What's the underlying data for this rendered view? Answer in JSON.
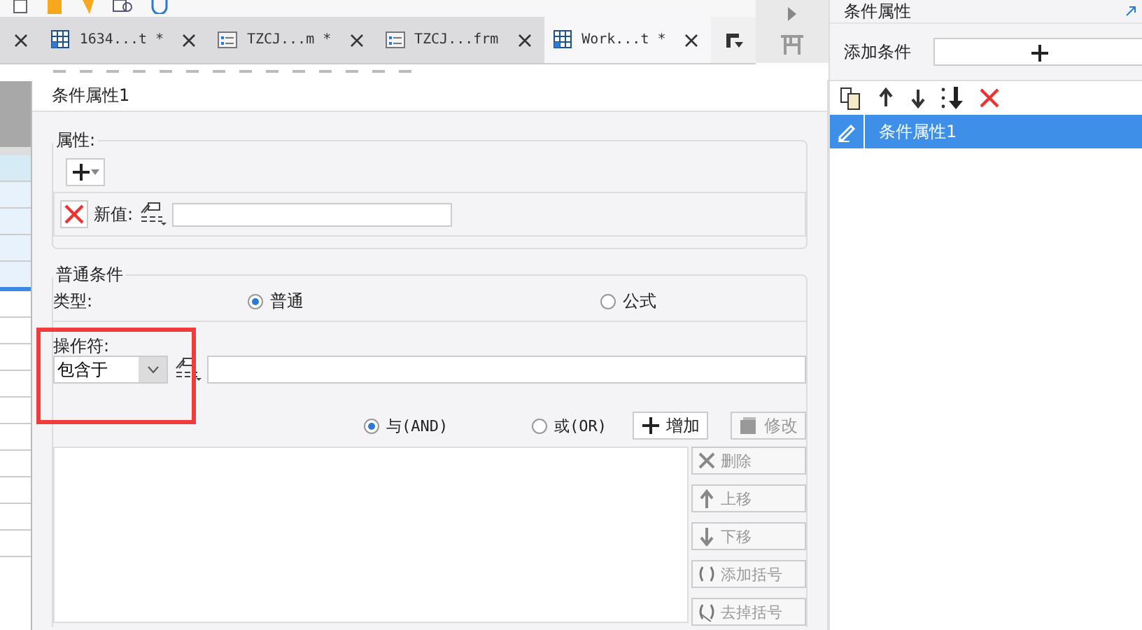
{
  "tabs": [
    {
      "label": "1634...t *",
      "kind": "grid",
      "selected": false
    },
    {
      "label": "TZCJ...m *",
      "kind": "form",
      "selected": false
    },
    {
      "label": "TZCJ...frm",
      "kind": "form",
      "selected": false
    },
    {
      "label": "Work...t *",
      "kind": "grid",
      "selected": true
    }
  ],
  "dialog": {
    "title": "条件属性1",
    "properties": {
      "legend": "属性:",
      "new_value_label": "新值:"
    },
    "general": {
      "legend": "普通条件",
      "type_label": "类型:",
      "type_options": [
        {
          "label": "普通",
          "selected": true
        },
        {
          "label": "公式",
          "selected": false
        }
      ],
      "operator_label": "操作符:",
      "operator_value": "包含于",
      "logic_options": [
        {
          "label": "与(AND)",
          "selected": true
        },
        {
          "label": "或(OR)",
          "selected": false
        }
      ],
      "buttons": [
        {
          "label": "增加",
          "kind": "add",
          "disabled": false
        },
        {
          "label": "修改",
          "kind": "edit",
          "disabled": true
        }
      ],
      "side_buttons": [
        {
          "label": "删除",
          "kind": "delete",
          "disabled": true
        },
        {
          "label": "上移",
          "kind": "up",
          "disabled": true
        },
        {
          "label": "下移",
          "kind": "down",
          "disabled": true
        },
        {
          "label": "添加括号",
          "kind": "paren",
          "disabled": true
        },
        {
          "label": "去掉括号",
          "kind": "unparen",
          "disabled": true
        }
      ]
    }
  },
  "side_panel": {
    "title": "条件属性",
    "add_label": "添加条件",
    "conditions": [
      {
        "label": "条件属性1",
        "selected": true
      }
    ]
  }
}
